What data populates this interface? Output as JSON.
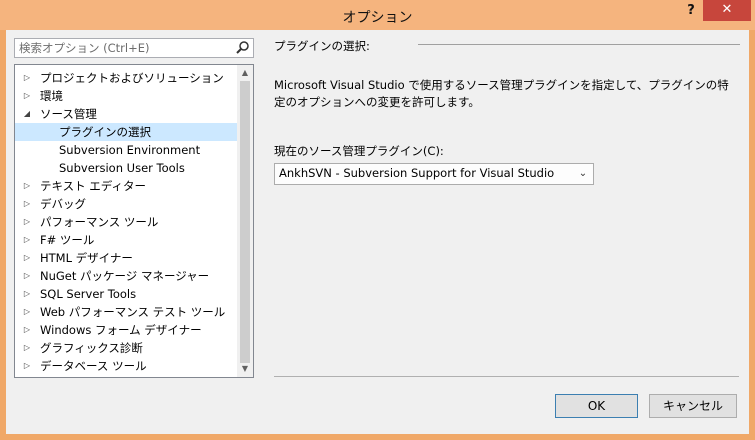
{
  "window": {
    "title": "オプション",
    "help_label": "?",
    "close_label": "✕"
  },
  "search": {
    "placeholder": "検索オプション (Ctrl+E)"
  },
  "tree": {
    "items": [
      {
        "label": "プロジェクトおよびソリューション",
        "arrow": "▷"
      },
      {
        "label": "環境",
        "arrow": "▷"
      },
      {
        "label": "ソース管理",
        "arrow": "◢"
      },
      {
        "label": "プラグインの選択",
        "arrow": ""
      },
      {
        "label": "Subversion Environment",
        "arrow": ""
      },
      {
        "label": "Subversion User Tools",
        "arrow": ""
      },
      {
        "label": "テキスト エディター",
        "arrow": "▷"
      },
      {
        "label": "デバッグ",
        "arrow": "▷"
      },
      {
        "label": "パフォーマンス ツール",
        "arrow": "▷"
      },
      {
        "label": "F# ツール",
        "arrow": "▷"
      },
      {
        "label": "HTML デザイナー",
        "arrow": "▷"
      },
      {
        "label": "NuGet パッケージ マネージャー",
        "arrow": "▷"
      },
      {
        "label": "SQL Server Tools",
        "arrow": "▷"
      },
      {
        "label": "Web パフォーマンス テスト ツール",
        "arrow": "▷"
      },
      {
        "label": "Windows フォーム デザイナー",
        "arrow": "▷"
      },
      {
        "label": "グラフィックス診断",
        "arrow": "▷"
      },
      {
        "label": "データベース ツール",
        "arrow": "▷"
      }
    ],
    "scroll_up": "▲",
    "scroll_down": "▼"
  },
  "panel": {
    "header": "プラグインの選択:",
    "description": "Microsoft Visual Studio で使用するソース管理プラグインを指定して、プラグインの特定のオプションへの変更を許可します。",
    "combo_label": "現在のソース管理プラグイン(C):",
    "combo_value": "AnkhSVN - Subversion Support for Visual Studio",
    "combo_arrow": "⌄"
  },
  "buttons": {
    "ok": "OK",
    "cancel": "キャンセル"
  },
  "colors": {
    "titlebar": "#f5b47e",
    "close": "#c7463c",
    "selection": "#cce8ff"
  }
}
